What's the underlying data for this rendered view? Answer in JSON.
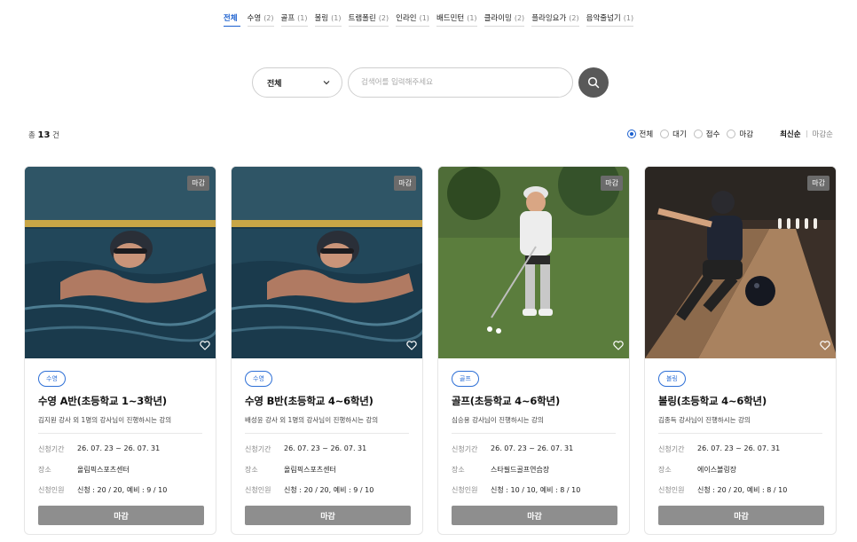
{
  "tabs": [
    {
      "label": "전체",
      "count": "",
      "active": true
    },
    {
      "label": "수영",
      "count": "(2)"
    },
    {
      "label": "골프",
      "count": "(1)"
    },
    {
      "label": "볼링",
      "count": "(1)"
    },
    {
      "label": "트램폴린",
      "count": "(2)"
    },
    {
      "label": "인라인",
      "count": "(1)"
    },
    {
      "label": "배드민턴",
      "count": "(1)"
    },
    {
      "label": "클라이밍",
      "count": "(2)"
    },
    {
      "label": "플라잉요가",
      "count": "(2)"
    },
    {
      "label": "음악줄넘기",
      "count": "(1)"
    }
  ],
  "search": {
    "select_value": "전체",
    "placeholder": "검색어를 입력해주세요",
    "value": ""
  },
  "summary": {
    "prefix": "총",
    "count": "13",
    "suffix": "건"
  },
  "status_filters": [
    {
      "label": "전체",
      "selected": true
    },
    {
      "label": "대기",
      "selected": false
    },
    {
      "label": "접수",
      "selected": false
    },
    {
      "label": "마감",
      "selected": false
    }
  ],
  "sort": {
    "latest": "최신순",
    "deadline": "마감순"
  },
  "colors": {
    "accent": "#1a5fcf",
    "chip": "#2d6fd6",
    "closed_button": "#8e8e8e",
    "search_button": "#595959"
  },
  "labels": {
    "period": "신청기간",
    "place": "장소",
    "capacity": "신청인원",
    "closed_badge": "마감",
    "heart_icon": "heart-outline-icon"
  },
  "cards": [
    {
      "image": "swimming",
      "badge": "마감",
      "category": "수영",
      "title": "수영 A반(초등학교 1~3학년)",
      "desc": "김지원 강사 외 1명의 강사님이 진행하시는 강의",
      "period": "26. 07. 23 ~ 26. 07. 31",
      "place": "올림픽스포츠센터",
      "capacity": "신청 : 20 / 20, 예비 : 9 / 10",
      "button": "마감"
    },
    {
      "image": "swimming",
      "badge": "마감",
      "category": "수영",
      "title": "수영 B반(초등학교 4~6학년)",
      "desc": "배성윤 강사 외 1명의 강사님이 진행하시는 강의",
      "period": "26. 07. 23 ~ 26. 07. 31",
      "place": "올림픽스포츠센터",
      "capacity": "신청 : 20 / 20, 예비 : 9 / 10",
      "button": "마감"
    },
    {
      "image": "golf",
      "badge": "마감",
      "category": "골프",
      "title": "골프(초등학교 4~6학년)",
      "desc": "심승용 강사님이 진행하시는 강의",
      "period": "26. 07. 23 ~ 26. 07. 31",
      "place": "스타필드골프연습장",
      "capacity": "신청 : 10 / 10, 예비 : 8 / 10",
      "button": "마감"
    },
    {
      "image": "bowling",
      "badge": "마감",
      "category": "볼링",
      "title": "볼링(초등학교 4~6학년)",
      "desc": "김종득 강사님이 진행하시는 강의",
      "period": "26. 07. 23 ~ 26. 07. 31",
      "place": "에이스볼링장",
      "capacity": "신청 : 20 / 20, 예비 : 8 / 10",
      "button": "마감"
    }
  ]
}
